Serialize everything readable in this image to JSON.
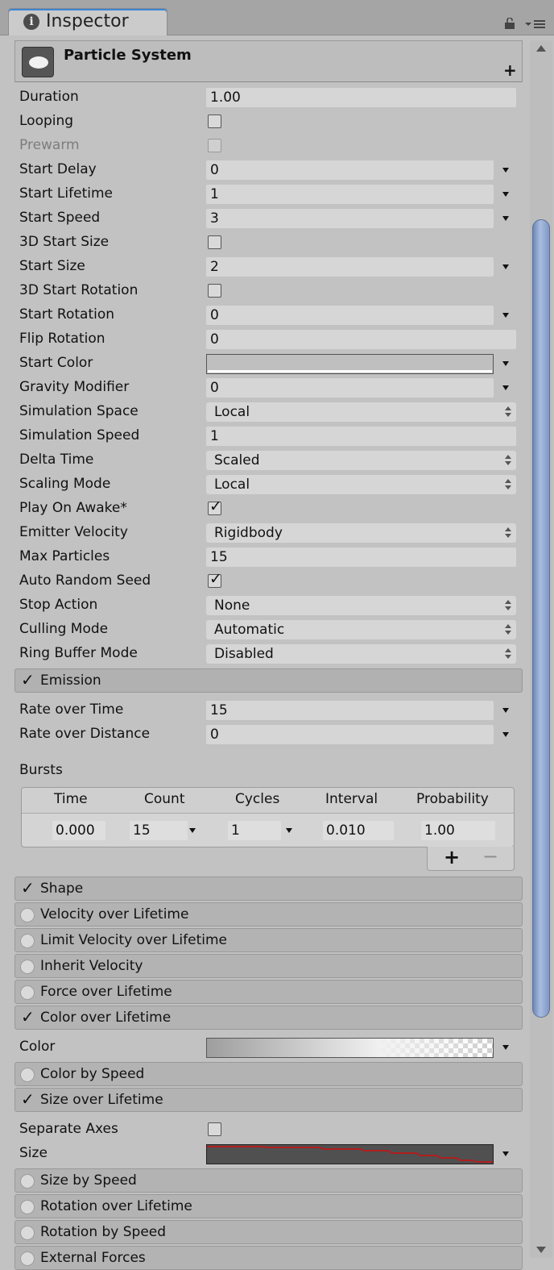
{
  "tab": {
    "title": "Inspector"
  },
  "component": {
    "title": "Particle System"
  },
  "main_props": [
    {
      "label": "Duration",
      "kind": "text",
      "value": "1.00"
    },
    {
      "label": "Looping",
      "kind": "checkbox",
      "checked": false
    },
    {
      "label": "Prewarm",
      "kind": "checkbox",
      "checked": false,
      "disabled": true
    },
    {
      "label": "Start Delay",
      "kind": "curve",
      "value": "0"
    },
    {
      "label": "Start Lifetime",
      "kind": "curve",
      "value": "1"
    },
    {
      "label": "Start Speed",
      "kind": "curve",
      "value": "3"
    },
    {
      "label": "3D Start Size",
      "kind": "checkbox",
      "checked": false
    },
    {
      "label": "Start Size",
      "kind": "curve",
      "value": "2"
    },
    {
      "label": "3D Start Rotation",
      "kind": "checkbox",
      "checked": false
    },
    {
      "label": "Start Rotation",
      "kind": "curve",
      "value": "0"
    },
    {
      "label": "Flip Rotation",
      "kind": "text",
      "value": "0"
    },
    {
      "label": "Start Color",
      "kind": "color"
    },
    {
      "label": "Gravity Modifier",
      "kind": "curve",
      "value": "0"
    },
    {
      "label": "Simulation Space",
      "kind": "select",
      "value": "Local"
    },
    {
      "label": "Simulation Speed",
      "kind": "text",
      "value": "1"
    },
    {
      "label": "Delta Time",
      "kind": "select",
      "value": "Scaled"
    },
    {
      "label": "Scaling Mode",
      "kind": "select",
      "value": "Local"
    },
    {
      "label": "Play On Awake*",
      "kind": "checkbox",
      "checked": true
    },
    {
      "label": "Emitter Velocity",
      "kind": "select",
      "value": "Rigidbody"
    },
    {
      "label": "Max Particles",
      "kind": "text",
      "value": "15"
    },
    {
      "label": "Auto Random Seed",
      "kind": "checkbox",
      "checked": true
    },
    {
      "label": "Stop Action",
      "kind": "select",
      "value": "None"
    },
    {
      "label": "Culling Mode",
      "kind": "select",
      "value": "Automatic"
    },
    {
      "label": "Ring Buffer Mode",
      "kind": "select",
      "value": "Disabled"
    }
  ],
  "emission": {
    "label": "Emission",
    "props": [
      {
        "label": "Rate over Time",
        "kind": "curve",
        "value": "15"
      },
      {
        "label": "Rate over Distance",
        "kind": "curve",
        "value": "0"
      }
    ],
    "bursts_label": "Bursts",
    "bursts_columns": [
      "Time",
      "Count",
      "Cycles",
      "Interval",
      "Probability"
    ],
    "bursts_row": {
      "time": "0.000",
      "count": "15",
      "cycles": "1",
      "interval": "0.010",
      "probability": "1.00"
    },
    "add_symbol": "+",
    "remove_symbol": "−"
  },
  "modules_a": [
    {
      "label": "Shape",
      "enabled": true
    },
    {
      "label": "Velocity over Lifetime",
      "enabled": false
    },
    {
      "label": "Limit Velocity over Lifetime",
      "enabled": false
    },
    {
      "label": "Inherit Velocity",
      "enabled": false
    },
    {
      "label": "Force over Lifetime",
      "enabled": false
    },
    {
      "label": "Color over Lifetime",
      "enabled": true
    }
  ],
  "color_over_lifetime": {
    "label": "Color"
  },
  "modules_b": [
    {
      "label": "Color by Speed",
      "enabled": false
    },
    {
      "label": "Size over Lifetime",
      "enabled": true
    }
  ],
  "size_over_lifetime": {
    "props": [
      {
        "label": "Separate Axes",
        "kind": "checkbox",
        "checked": false
      },
      {
        "label": "Size",
        "kind": "curvegraph"
      }
    ],
    "curve_color": "#b01e1e"
  },
  "modules_c": [
    {
      "label": "Size by Speed",
      "enabled": false
    },
    {
      "label": "Rotation over Lifetime",
      "enabled": false
    },
    {
      "label": "Rotation by Speed",
      "enabled": false
    },
    {
      "label": "External Forces",
      "enabled": false
    }
  ],
  "colors": {
    "accent": "#3d86d8",
    "scroll_thumb": "#8aa2cf"
  }
}
